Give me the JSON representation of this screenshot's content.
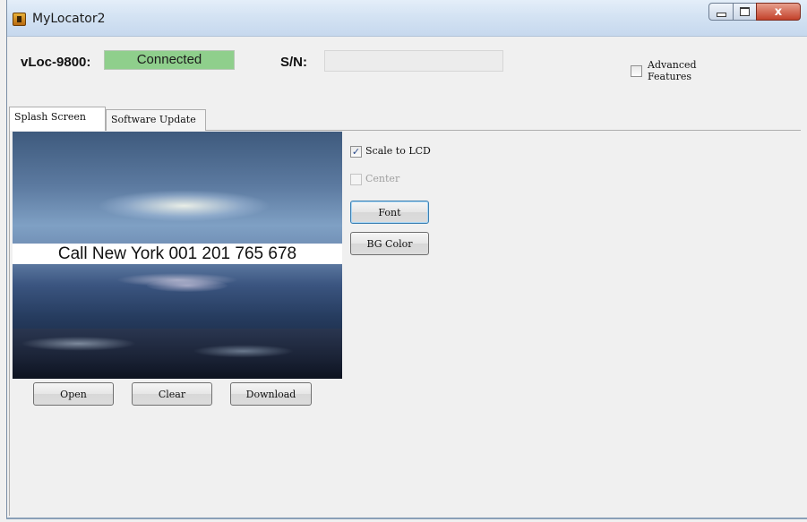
{
  "window": {
    "title": "MyLocator2"
  },
  "caption_buttons": {
    "minimize": "minimize",
    "maximize": "maximize",
    "close": "x"
  },
  "header": {
    "device_label": "vLoc-9800:",
    "status": "Connected",
    "status_color": "#8fcf8c",
    "sn_label": "S/N:",
    "sn_value": "",
    "advanced_features_line1": "Advanced",
    "advanced_features_line2": "Features",
    "advanced_features_checked": false
  },
  "tabs": [
    {
      "label": "Splash Screen",
      "active": true
    },
    {
      "label": "Software Update",
      "active": false
    }
  ],
  "splash": {
    "caption": "Call New York 001 201 765 678",
    "buttons": {
      "open": "Open",
      "clear": "Clear",
      "download": "Download"
    }
  },
  "options": {
    "scale_to_lcd": {
      "label": "Scale to LCD",
      "checked": true
    },
    "center": {
      "label": "Center",
      "checked": false,
      "enabled": false
    },
    "font_button": "Font",
    "bg_color_button": "BG Color"
  },
  "icons": {
    "app": "locator-app-icon",
    "check": "checkmark-icon"
  }
}
